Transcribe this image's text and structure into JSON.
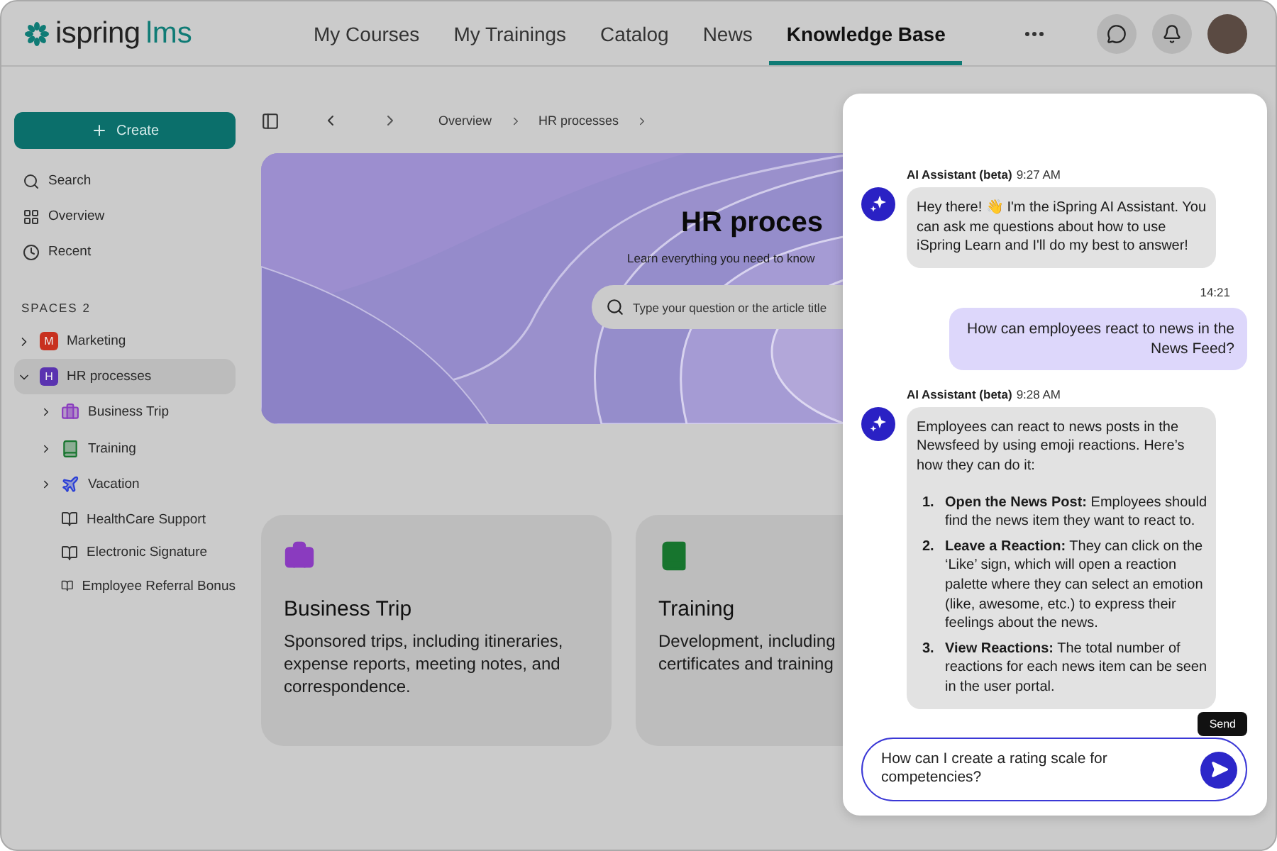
{
  "logo": {
    "brand": "ispring",
    "product": "lms"
  },
  "nav": [
    {
      "label": "My Courses",
      "selected": false
    },
    {
      "label": "My Trainings",
      "selected": false
    },
    {
      "label": "Catalog",
      "selected": false
    },
    {
      "label": "News",
      "selected": false
    },
    {
      "label": "Knowledge Base",
      "selected": true
    }
  ],
  "sidebar": {
    "create": "Create",
    "links": [
      {
        "kind": "search",
        "label": "Search"
      },
      {
        "kind": "overview",
        "label": "Overview"
      },
      {
        "kind": "recent",
        "label": "Recent"
      }
    ],
    "spaces_label": "SPACES 2",
    "spaces": [
      {
        "name": "Marketing",
        "badge": "M",
        "color": "#c8311f",
        "expanded": false,
        "selected": false
      },
      {
        "name": "HR processes",
        "badge": "H",
        "color": "#5a33b0",
        "expanded": true,
        "selected": true,
        "children": [
          {
            "kind": "briefcase",
            "name": "Business Trip",
            "color": "#8a3bbf",
            "expanded": false
          },
          {
            "kind": "book",
            "name": "Training",
            "color": "#17752e",
            "expanded": false
          },
          {
            "kind": "plane",
            "name": "Vacation",
            "color": "#2a3fd6",
            "expanded": false
          },
          {
            "kind": "article",
            "name": "HealthCare Support"
          },
          {
            "kind": "article",
            "name": "Electronic Signature"
          },
          {
            "kind": "article",
            "name": "Employee Referral Bonus"
          }
        ]
      }
    ]
  },
  "breadcrumbs": [
    "Overview",
    "HR processes"
  ],
  "hero": {
    "title": "HR proces",
    "subtitle": "Learn everything you need to know",
    "search_placeholder": "Type your question or the article title"
  },
  "cards": [
    {
      "kind": "briefcase",
      "color": "#8a3bbf",
      "title": "Business Trip",
      "description": "Sponsored trips, including itineraries, expense reports, meeting notes, and correspondence."
    },
    {
      "kind": "book",
      "color": "#17752e",
      "title": "Training",
      "description": "Development, including certificates and training"
    }
  ],
  "chat": {
    "messages": [
      {
        "kind": "bot",
        "author": "AI Assistant (beta)",
        "time": "9:27 AM",
        "text": "Hey there! 👋 I'm the iSpring AI Assistant. You can ask me questions about how to use iSpring Learn and I'll do my best to answer!"
      },
      {
        "kind": "user",
        "time": "14:21",
        "text": "How can employees react to news in the News Feed?"
      },
      {
        "kind": "bot",
        "author": "AI Assistant (beta)",
        "time": "9:28 AM",
        "text": "Employees can react to news posts in the Newsfeed by using emoji reactions. Here’s how they can do it:",
        "steps": [
          {
            "number": "1.",
            "text": "**Open the News Post:** Employees should find the news item they want to react to."
          },
          {
            "number": "2.",
            "text": "**Leave a Reaction:** They can click on the ‘Like’ sign, which will open a reaction palette where they can select an emotion (like, awesome, etc.) to express their feelings about the news."
          },
          {
            "number": "3.",
            "text": "**View Reactions:** The total number of reactions for each news item can be seen in the user portal."
          }
        ]
      }
    ],
    "input_value": "How can I create a rating scale for competencies?",
    "send_tooltip": "Send"
  }
}
